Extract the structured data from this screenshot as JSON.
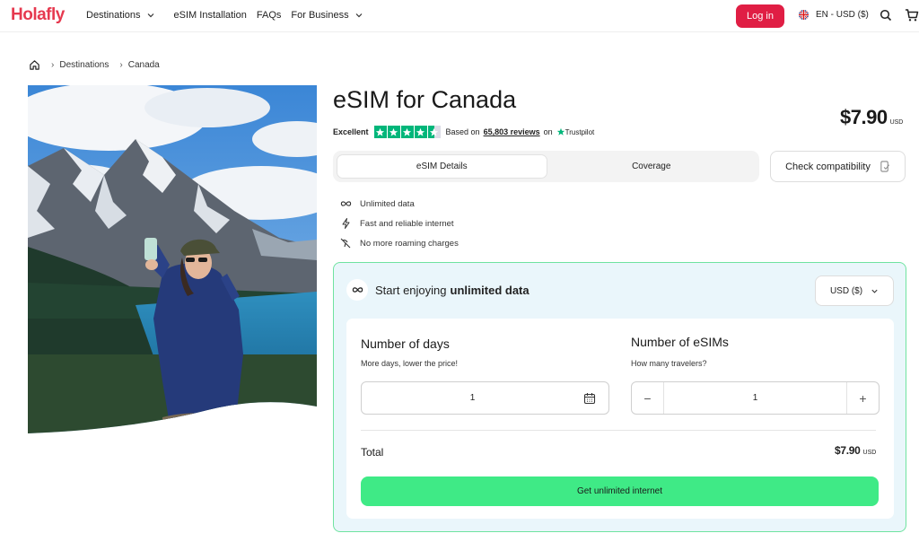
{
  "header": {
    "logo": "Holafly",
    "nav": [
      {
        "label": "Destinations",
        "has_dropdown": true
      },
      {
        "label": "eSIM Installation",
        "has_dropdown": false
      },
      {
        "label": "FAQs",
        "has_dropdown": false
      },
      {
        "label": "For Business",
        "has_dropdown": true
      }
    ],
    "login_label": "Log in",
    "language_label": "EN - USD ($)",
    "icons": [
      "uk-flag-icon",
      "search-icon",
      "cart-icon"
    ]
  },
  "breadcrumb": {
    "items": [
      "Destinations",
      "Canada"
    ],
    "home_icon": "home-icon"
  },
  "product": {
    "title": "eSIM for Canada",
    "rating": {
      "label": "Excellent",
      "stars": 4.5,
      "based_on": "Based on",
      "reviews": "65,803 reviews",
      "on": "on",
      "provider": "Trustpilot"
    },
    "price": "$7.90",
    "currency": "USD"
  },
  "tabs": [
    {
      "label": "eSIM Details",
      "active": true
    },
    {
      "label": "Coverage",
      "active": false
    }
  ],
  "check_compatibility": "Check compatibility",
  "features": [
    {
      "icon": "infinity-icon",
      "label": "Unlimited data"
    },
    {
      "icon": "lightning-icon",
      "label": "Fast and reliable internet"
    },
    {
      "icon": "no-roaming-icon",
      "label": "No more roaming charges"
    }
  ],
  "plan": {
    "heading_prefix": "Start enjoying",
    "heading_bold": "unlimited data",
    "currency_select": "USD ($)",
    "days": {
      "label": "Number of days",
      "hint": "More days, lower the price!",
      "value": "1"
    },
    "esims": {
      "label": "Number of eSIMs",
      "hint": "How many travelers?",
      "value": "1",
      "minus": "−",
      "plus": "+"
    },
    "total_label": "Total",
    "total_value": "$7.90",
    "total_currency": "USD",
    "cta": "Get unlimited internet"
  },
  "colors": {
    "brand": "#e6394f",
    "login": "#e01e44",
    "cta": "#3fea86",
    "panel_bg": "#eaf6fb",
    "panel_border": "#6fe3a0",
    "trustpilot": "#00b67a"
  }
}
